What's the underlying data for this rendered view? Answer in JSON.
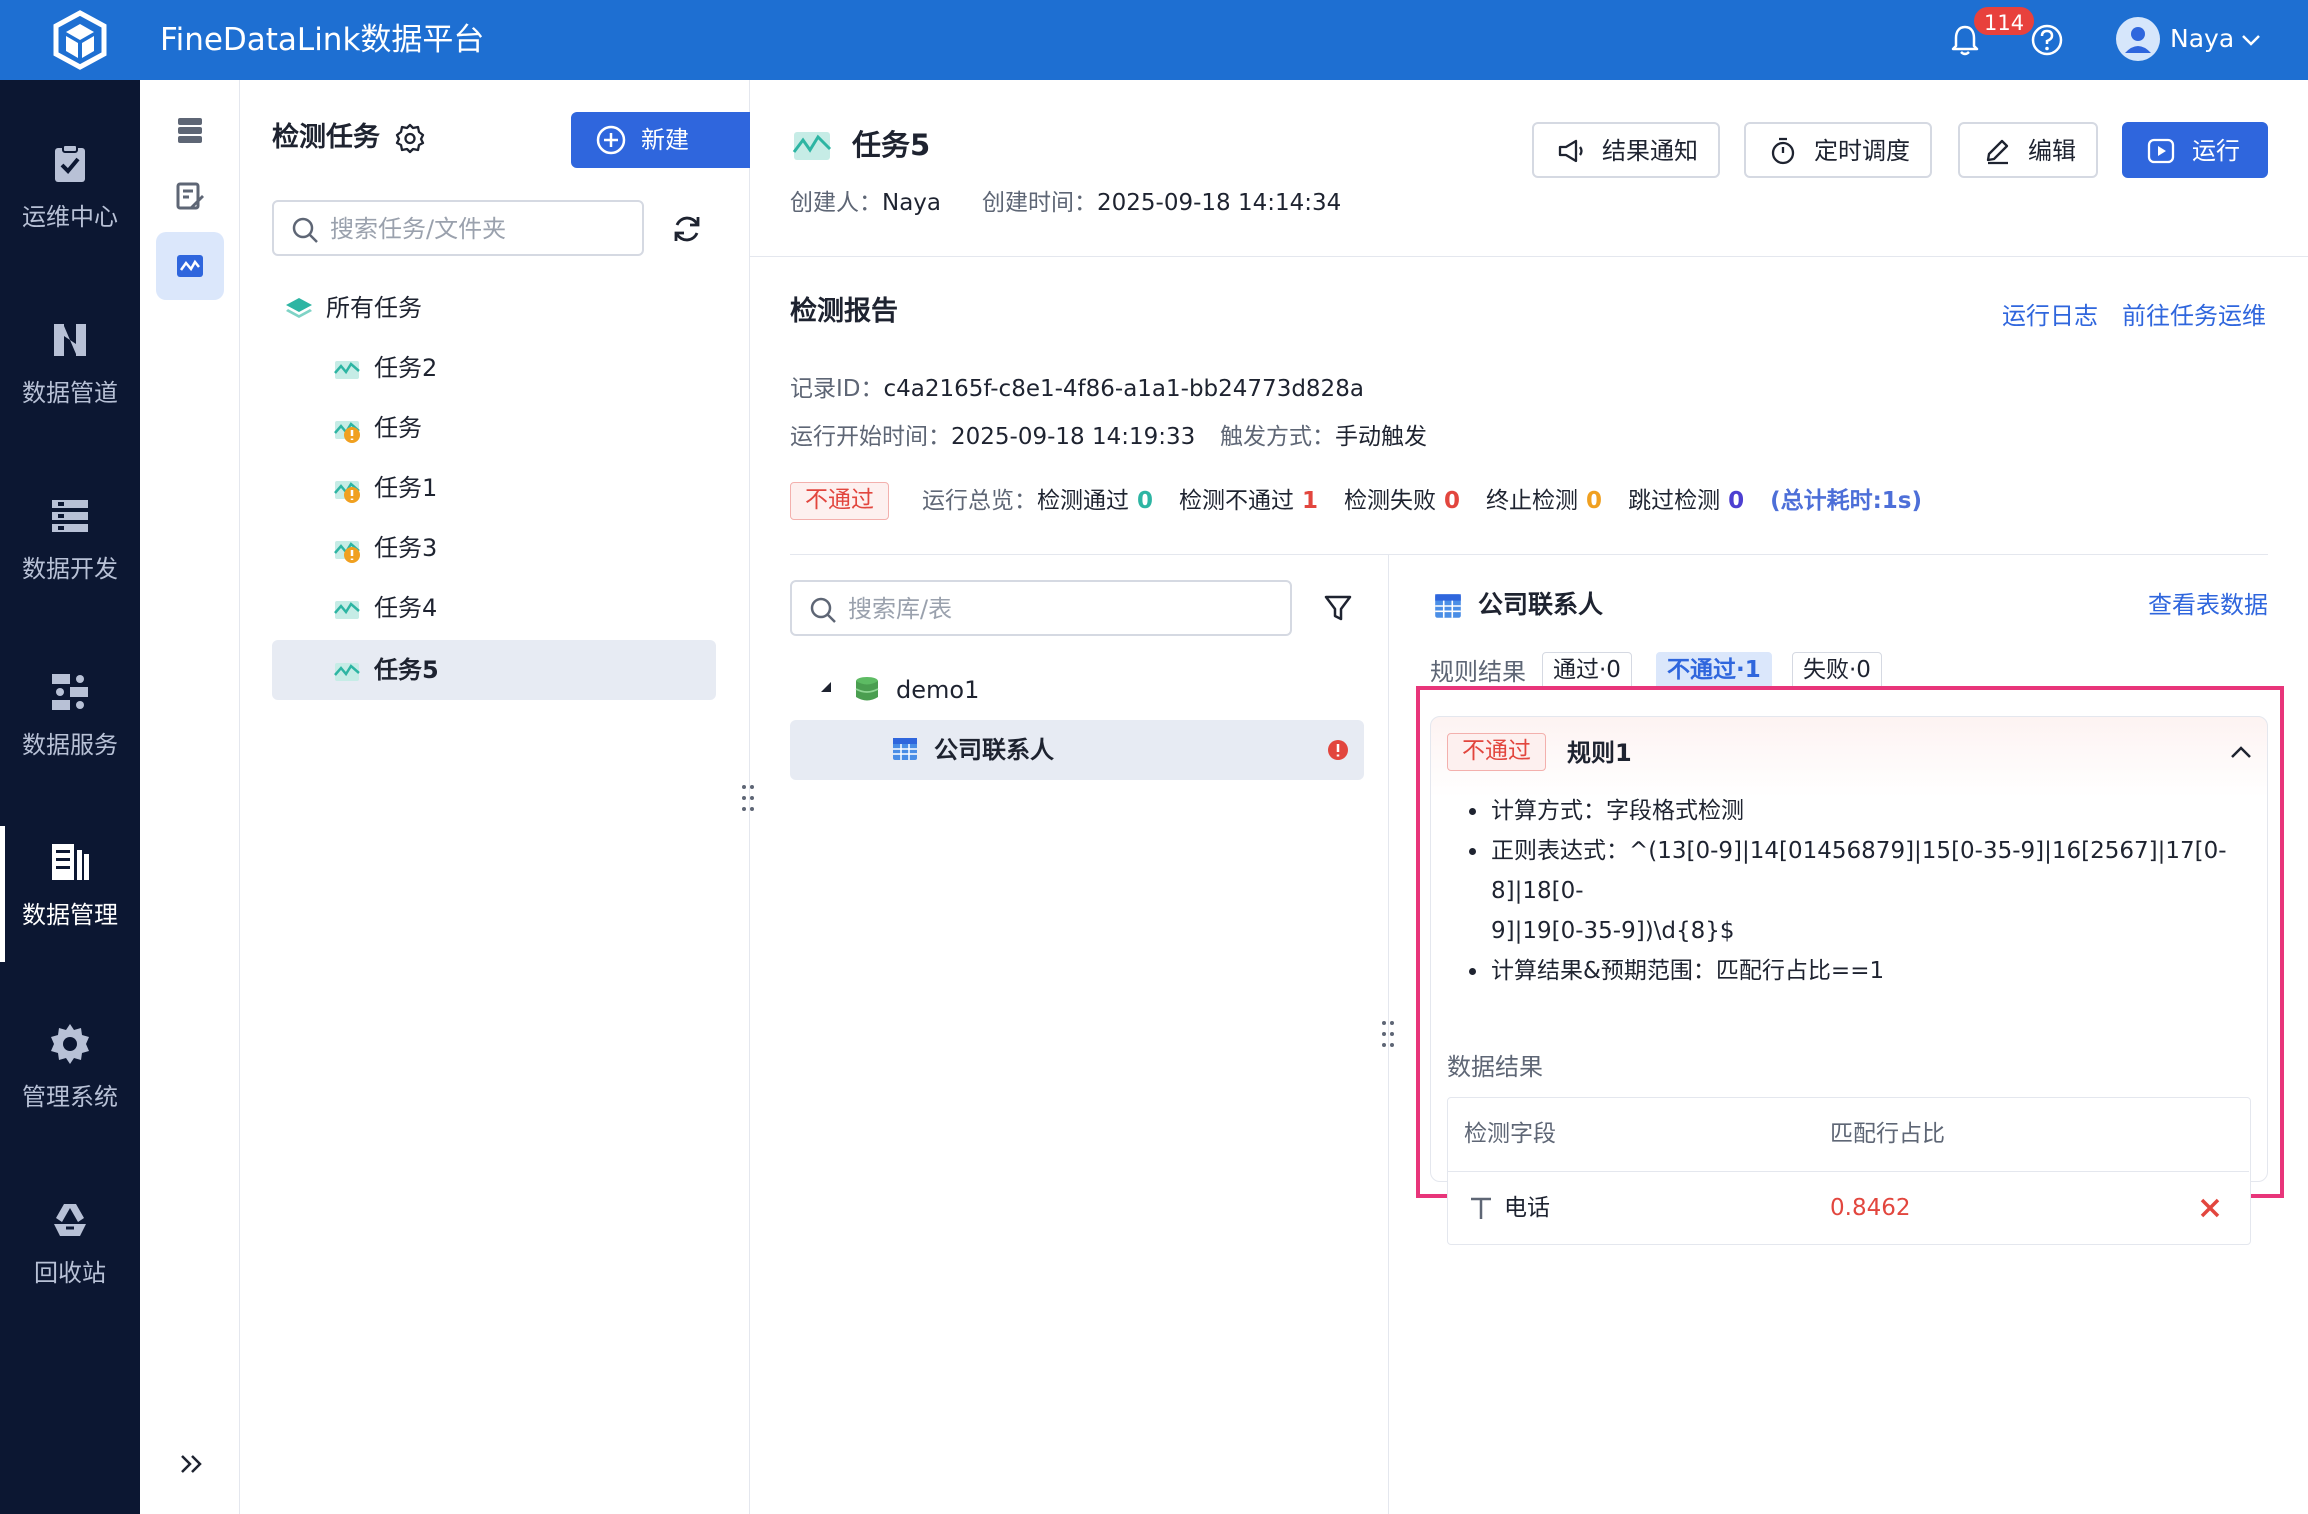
{
  "header": {
    "app_title": "FineDataLink数据平台",
    "notification_count": "114",
    "user_name": "Naya"
  },
  "nav": [
    {
      "label": "运维中心",
      "icon": "clipboard-check-icon"
    },
    {
      "label": "数据管道",
      "icon": "pipeline-icon"
    },
    {
      "label": "数据开发",
      "icon": "dev-icon"
    },
    {
      "label": "数据服务",
      "icon": "service-icon"
    },
    {
      "label": "数据管理",
      "icon": "data-management-icon",
      "active": true
    },
    {
      "label": "管理系统",
      "icon": "gear-icon"
    },
    {
      "label": "回收站",
      "icon": "recycle-icon"
    }
  ],
  "task_panel": {
    "title": "检测任务",
    "new_label": "新建",
    "search_placeholder": "搜索任务/文件夹",
    "root_label": "所有任务",
    "tasks": [
      {
        "name": "任务2",
        "warning": false
      },
      {
        "name": "任务",
        "warning": true
      },
      {
        "name": "任务1",
        "warning": true
      },
      {
        "name": "任务3",
        "warning": true
      },
      {
        "name": "任务4",
        "warning": false
      },
      {
        "name": "任务5",
        "warning": false,
        "selected": true
      }
    ]
  },
  "task": {
    "name": "任务5",
    "creator_label": "创建人：",
    "creator": "Naya",
    "created_label": "创建时间：",
    "created_at": "2025-09-18 14:14:34"
  },
  "toolbar": {
    "notify_label": "结果通知",
    "schedule_label": "定时调度",
    "edit_label": "编辑",
    "run_label": "运行"
  },
  "report": {
    "title": "检测报告",
    "run_log_link": "运行日志",
    "goto_ops_link": "前往任务运维",
    "record_id_label": "记录ID：",
    "record_id": "c4a2165f-c8e1-4f86-a1a1-bb24773d828a",
    "start_label": "运行开始时间：",
    "start_time": "2025-09-18 14:19:33",
    "trigger_label": "触发方式：",
    "trigger": "手动触发",
    "status_tag": "不通过",
    "overview_label": "运行总览：",
    "passed_label": "检测通过",
    "passed": "0",
    "not_passed_label": "检测不通过",
    "not_passed": "1",
    "failed_label": "检测失败",
    "failed": "0",
    "stopped_label": "终止检测",
    "stopped": "0",
    "skipped_label": "跳过检测",
    "skipped": "0",
    "total_time": "(总计耗时:1s)"
  },
  "db_tree": {
    "search_placeholder": "搜索库/表",
    "database": "demo1",
    "table": "公司联系人"
  },
  "detail": {
    "table_name": "公司联系人",
    "view_data_link": "查看表数据",
    "rule_result_label": "规则结果",
    "pill_pass": "通过·0",
    "pill_notpass": "不通过·1",
    "pill_fail": "失败·0",
    "rule": {
      "status_tag": "不通过",
      "name": "规则1",
      "calc_method": "计算方式：字段格式检测",
      "regex_line1": "正则表达式：^(13[0-9]|14[01456879]|15[0-35-9]|16[2567]|17[0-8]|18[0-",
      "regex_line2": "9]|19[0-35-9])\\d{8}$",
      "expected": "计算结果&预期范围：匹配行占比==1"
    },
    "data_result_label": "数据结果",
    "col_field": "检测字段",
    "col_ratio": "匹配行占比",
    "row_field": "电话",
    "row_ratio": "0.8462"
  },
  "colors": {
    "brand": "#1e6fd2",
    "primary": "#2f66dd",
    "nav_bg": "#0c1732",
    "fail": "#e2463e",
    "highlight": "#e8357a"
  }
}
